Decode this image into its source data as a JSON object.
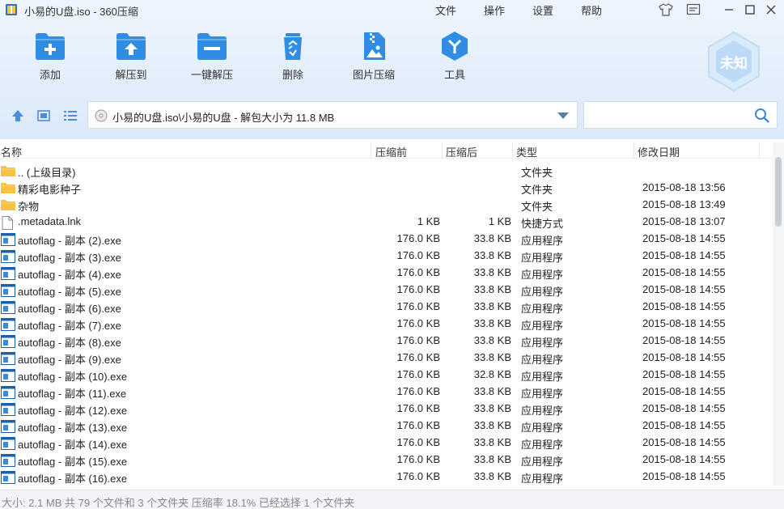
{
  "window": {
    "title": "小易的U盘.iso - 360压缩",
    "menu": [
      "文件",
      "操作",
      "设置",
      "帮助"
    ]
  },
  "toolbar": {
    "add": "添加",
    "extract_to": "解压到",
    "one_click": "一键解压",
    "delete": "删除",
    "image_compress": "图片压缩",
    "tools": "工具",
    "badge": "未知"
  },
  "address": {
    "path": "小易的U盘.iso\\小易的U盘 - 解包大小为 11.8 MB",
    "search_placeholder": ""
  },
  "columns": {
    "name": "名称",
    "orig": "压缩前",
    "comp": "压缩后",
    "type": "类型",
    "date": "修改日期"
  },
  "rows": [
    {
      "icon": "folder-icon",
      "name": ".. (上级目录)",
      "orig": "",
      "comp": "",
      "type": "文件夹",
      "date": ""
    },
    {
      "icon": "folder-icon",
      "name": "精彩电影种子",
      "orig": "",
      "comp": "",
      "type": "文件夹",
      "date": "2015-08-18 13:56"
    },
    {
      "icon": "folder-icon",
      "name": "杂物",
      "orig": "",
      "comp": "",
      "type": "文件夹",
      "date": "2015-08-18 13:49"
    },
    {
      "icon": "file-icon",
      "name": ".metadata.lnk",
      "orig": "1 KB",
      "comp": "1 KB",
      "type": "快捷方式",
      "date": "2015-08-18 13:07"
    },
    {
      "icon": "exe-icon",
      "name": "autoflag - 副本 (2).exe",
      "orig": "176.0 KB",
      "comp": "33.8 KB",
      "type": "应用程序",
      "date": "2015-08-18 14:55"
    },
    {
      "icon": "exe-icon",
      "name": "autoflag - 副本 (3).exe",
      "orig": "176.0 KB",
      "comp": "33.8 KB",
      "type": "应用程序",
      "date": "2015-08-18 14:55"
    },
    {
      "icon": "exe-icon",
      "name": "autoflag - 副本 (4).exe",
      "orig": "176.0 KB",
      "comp": "33.8 KB",
      "type": "应用程序",
      "date": "2015-08-18 14:55"
    },
    {
      "icon": "exe-icon",
      "name": "autoflag - 副本 (5).exe",
      "orig": "176.0 KB",
      "comp": "33.8 KB",
      "type": "应用程序",
      "date": "2015-08-18 14:55"
    },
    {
      "icon": "exe-icon",
      "name": "autoflag - 副本 (6).exe",
      "orig": "176.0 KB",
      "comp": "33.8 KB",
      "type": "应用程序",
      "date": "2015-08-18 14:55"
    },
    {
      "icon": "exe-icon",
      "name": "autoflag - 副本 (7).exe",
      "orig": "176.0 KB",
      "comp": "33.8 KB",
      "type": "应用程序",
      "date": "2015-08-18 14:55"
    },
    {
      "icon": "exe-icon",
      "name": "autoflag - 副本 (8).exe",
      "orig": "176.0 KB",
      "comp": "33.8 KB",
      "type": "应用程序",
      "date": "2015-08-18 14:55"
    },
    {
      "icon": "exe-icon",
      "name": "autoflag - 副本 (9).exe",
      "orig": "176.0 KB",
      "comp": "33.8 KB",
      "type": "应用程序",
      "date": "2015-08-18 14:55"
    },
    {
      "icon": "exe-icon",
      "name": "autoflag - 副本 (10).exe",
      "orig": "176.0 KB",
      "comp": "32.8 KB",
      "type": "应用程序",
      "date": "2015-08-18 14:55"
    },
    {
      "icon": "exe-icon",
      "name": "autoflag - 副本 (11).exe",
      "orig": "176.0 KB",
      "comp": "33.8 KB",
      "type": "应用程序",
      "date": "2015-08-18 14:55"
    },
    {
      "icon": "exe-icon",
      "name": "autoflag - 副本 (12).exe",
      "orig": "176.0 KB",
      "comp": "33.8 KB",
      "type": "应用程序",
      "date": "2015-08-18 14:55"
    },
    {
      "icon": "exe-icon",
      "name": "autoflag - 副本 (13).exe",
      "orig": "176.0 KB",
      "comp": "33.8 KB",
      "type": "应用程序",
      "date": "2015-08-18 14:55"
    },
    {
      "icon": "exe-icon",
      "name": "autoflag - 副本 (14).exe",
      "orig": "176.0 KB",
      "comp": "33.8 KB",
      "type": "应用程序",
      "date": "2015-08-18 14:55"
    },
    {
      "icon": "exe-icon",
      "name": "autoflag - 副本 (15).exe",
      "orig": "176.0 KB",
      "comp": "33.8 KB",
      "type": "应用程序",
      "date": "2015-08-18 14:55"
    },
    {
      "icon": "exe-icon",
      "name": "autoflag - 副本 (16).exe",
      "orig": "176.0 KB",
      "comp": "33.8 KB",
      "type": "应用程序",
      "date": "2015-08-18 14:55"
    }
  ],
  "status": "大小: 2.1 MB 共 79 个文件和 3 个文件夹 压缩率 18.1% 已经选择 1 个文件夹",
  "colors": {
    "accent": "#2f8de4",
    "folder": "#f7c244",
    "toolbar_bg": "#e3eefb"
  }
}
